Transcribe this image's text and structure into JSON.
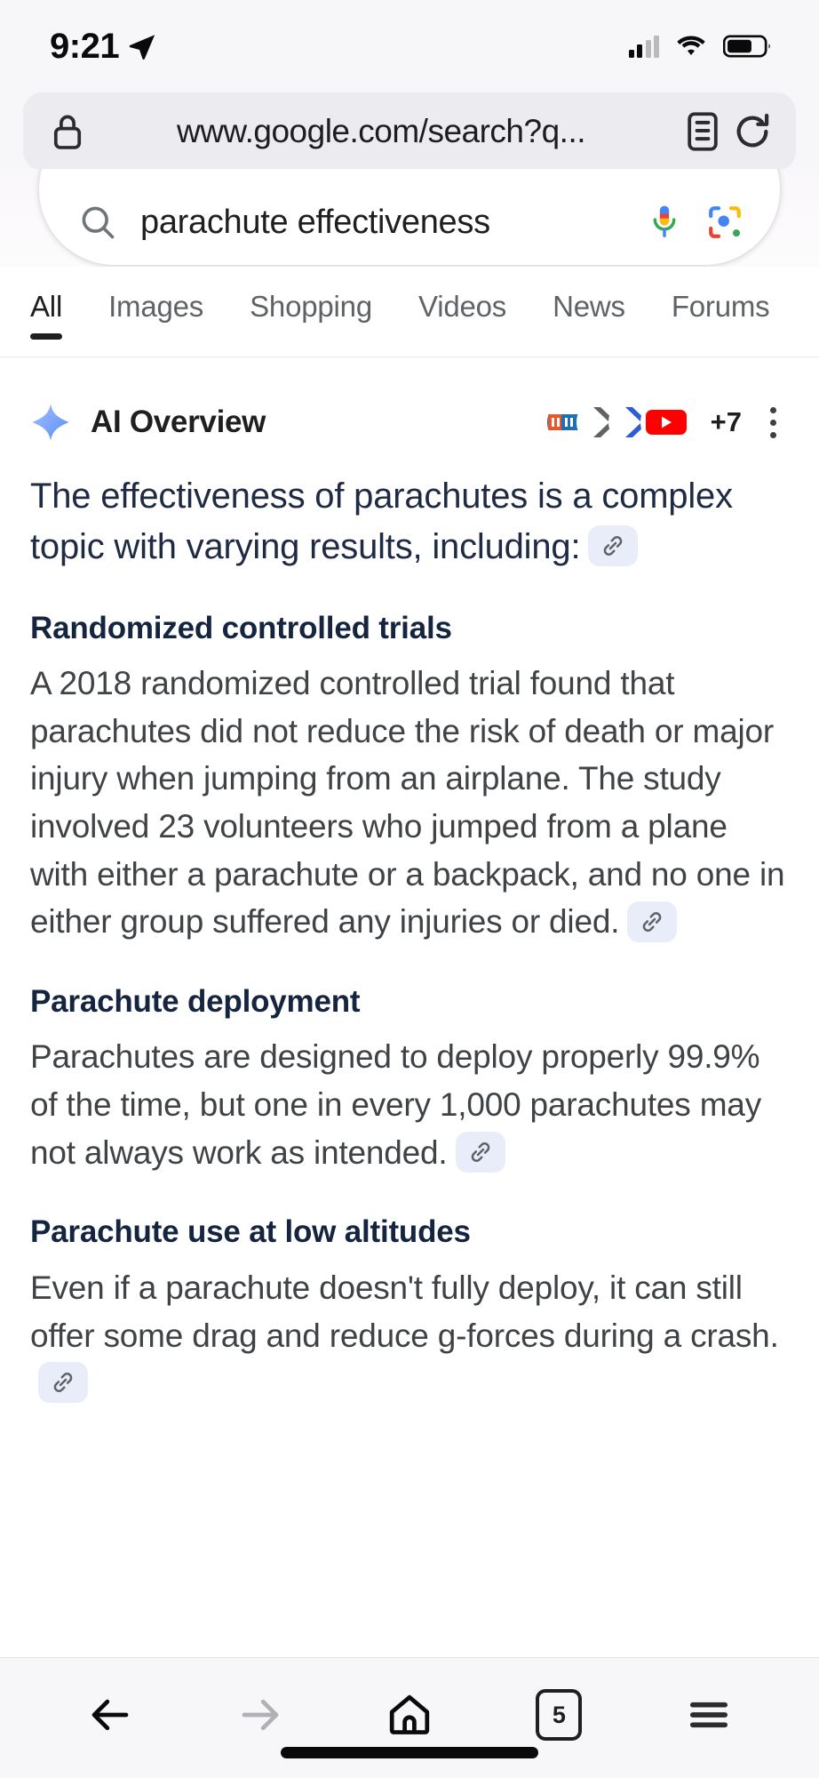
{
  "status_bar": {
    "time": "9:21",
    "location_icon": "location-arrow-icon",
    "signal_icon": "cellular-signal-icon",
    "wifi_icon": "wifi-icon",
    "battery_icon": "battery-icon"
  },
  "browser": {
    "lock_icon": "lock-icon",
    "url": "www.google.com/search?q...",
    "reader_icon": "reader-view-icon",
    "reload_icon": "reload-icon",
    "toolbar": {
      "back_label": "back-arrow-icon",
      "forward_label": "forward-arrow-icon",
      "home_label": "home-icon",
      "tab_count": "5",
      "menu_label": "hamburger-menu-icon"
    }
  },
  "google": {
    "search_icon": "search-icon",
    "query": "parachute effectiveness",
    "mic_icon": "google-microphone-icon",
    "lens_icon": "google-lens-icon",
    "tabs": [
      {
        "label": "All",
        "active": true
      },
      {
        "label": "Images",
        "active": false
      },
      {
        "label": "Shopping",
        "active": false
      },
      {
        "label": "Videos",
        "active": false
      },
      {
        "label": "News",
        "active": false
      },
      {
        "label": "Forums",
        "active": false
      }
    ]
  },
  "ai_overview": {
    "sparkle_icon": "ai-sparkle-icon",
    "title": "AI Overview",
    "sources_more": "+7",
    "menu_icon": "three-dot-menu-icon",
    "lead": "The effectiveness of parachutes is a complex topic with varying results, including:",
    "cite_icon": "link-citation-icon",
    "sections": [
      {
        "heading": "Randomized controlled trials",
        "body": "A 2018 randomized controlled trial found that parachutes did not reduce the risk of death or major injury when jumping from an airplane. The study involved 23 volunteers who jumped from a plane with either a parachute or a backpack, and no one in either group suffered any injuries or died."
      },
      {
        "heading": "Parachute deployment",
        "body": "Parachutes are designed to deploy properly 99.9% of the time, but one in every 1,000 parachutes may not always work as intended."
      },
      {
        "heading": "Parachute use at low altitudes",
        "body": "Even if a parachute doesn't fully deploy, it can still offer some drag and reduce g-forces during a crash."
      }
    ]
  },
  "colors": {
    "accent_blue": "#4285f4",
    "heading_navy": "#15243f",
    "body_gray": "#3f4346",
    "chip_bg": "#e8edf9",
    "chrome_bg": "#f7f7f9"
  }
}
